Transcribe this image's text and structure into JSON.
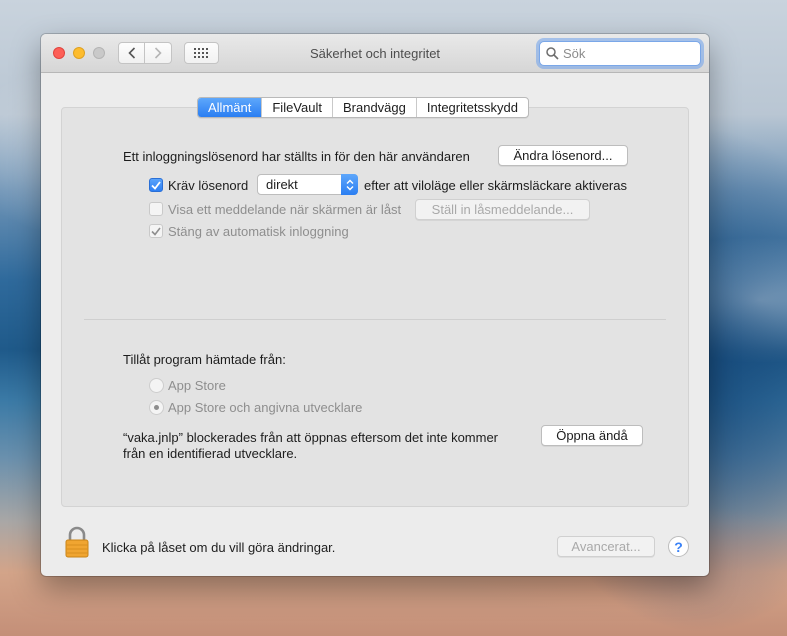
{
  "window": {
    "title": "Säkerhet och integritet",
    "search_placeholder": "Sök"
  },
  "tabs": [
    {
      "label": "Allmänt",
      "active": true
    },
    {
      "label": "FileVault",
      "active": false
    },
    {
      "label": "Brandvägg",
      "active": false
    },
    {
      "label": "Integritetsskydd",
      "active": false
    }
  ],
  "general": {
    "password_text": "Ett inloggningslösenord har ställts in för den här användaren",
    "change_password_button": "Ändra lösenord...",
    "require_password": {
      "label": "Kräv lösenord",
      "checked": true
    },
    "require_select_value": "direkt",
    "require_suffix": "efter att viloläge eller skärmsläckare aktiveras",
    "show_message": {
      "label": "Visa ett meddelande när skärmen är låst",
      "checked": false,
      "enabled": false
    },
    "set_lock_message_button": "Ställ in låsmeddelande...",
    "disable_auto_login": {
      "label": "Stäng av automatisk inloggning",
      "checked": true,
      "enabled": false
    }
  },
  "apps": {
    "heading": "Tillåt program hämtade från:",
    "options": [
      {
        "label": "App Store",
        "selected": false,
        "enabled": false
      },
      {
        "label": "App Store och angivna utvecklare",
        "selected": true,
        "enabled": false
      }
    ],
    "blocked_line1": "“vaka.jnlp” blockerades från att öppnas eftersom det inte kommer",
    "blocked_line2": "från en identifierad utvecklare.",
    "open_anyway_button": "Öppna ändå"
  },
  "footer": {
    "lock_text": "Klicka på låset om du vill göra ändringar.",
    "advanced_button": "Avancerat...",
    "help_label": "?"
  },
  "colors": {
    "accent": "#2a7ef2",
    "close": "#fd5f57",
    "minimize": "#fdbc2e",
    "lock": "#f0a531"
  }
}
